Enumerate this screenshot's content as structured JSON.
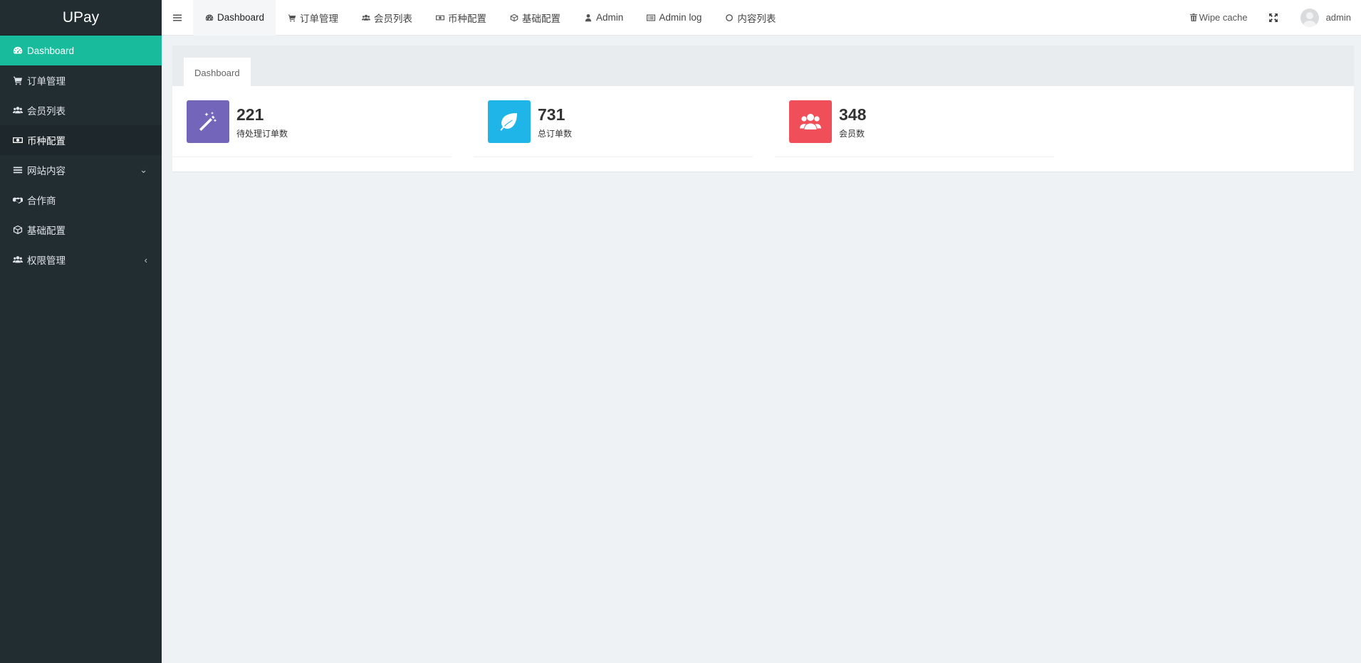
{
  "brand": "UPay",
  "sidebar": {
    "items": [
      {
        "label": "Dashboard",
        "icon": "dashboard-icon"
      },
      {
        "label": "订单管理",
        "icon": "cart-icon"
      },
      {
        "label": "会员列表",
        "icon": "users-icon"
      },
      {
        "label": "币种配置",
        "icon": "money-icon"
      },
      {
        "label": "网站内容",
        "icon": "list-icon",
        "arrow": "⌄"
      },
      {
        "label": "合作商",
        "icon": "handshake-icon"
      },
      {
        "label": "基础配置",
        "icon": "cube-icon"
      },
      {
        "label": "权限管理",
        "icon": "users-icon",
        "arrow": "‹"
      }
    ]
  },
  "topnav": {
    "tabs": [
      {
        "label": "Dashboard",
        "icon": "dashboard-icon"
      },
      {
        "label": "订单管理",
        "icon": "cart-icon"
      },
      {
        "label": "会员列表",
        "icon": "users-icon"
      },
      {
        "label": "币种配置",
        "icon": "money-icon"
      },
      {
        "label": "基础配置",
        "icon": "cube-icon"
      },
      {
        "label": "Admin",
        "icon": "user-icon"
      },
      {
        "label": "Admin log",
        "icon": "list-alt-icon"
      },
      {
        "label": "内容列表",
        "icon": "circle-icon"
      }
    ],
    "wipe_cache": "Wipe cache",
    "user_name": "admin"
  },
  "content": {
    "tab_label": "Dashboard",
    "stats": [
      {
        "value": "221",
        "label": "待处理订单数",
        "color": "#7265ba",
        "icon": "magic-icon"
      },
      {
        "value": "731",
        "label": "总订单数",
        "color": "#1fb5e8",
        "icon": "leaf-icon"
      },
      {
        "value": "348",
        "label": "会员数",
        "color": "#f04f59",
        "icon": "users-icon"
      }
    ]
  }
}
